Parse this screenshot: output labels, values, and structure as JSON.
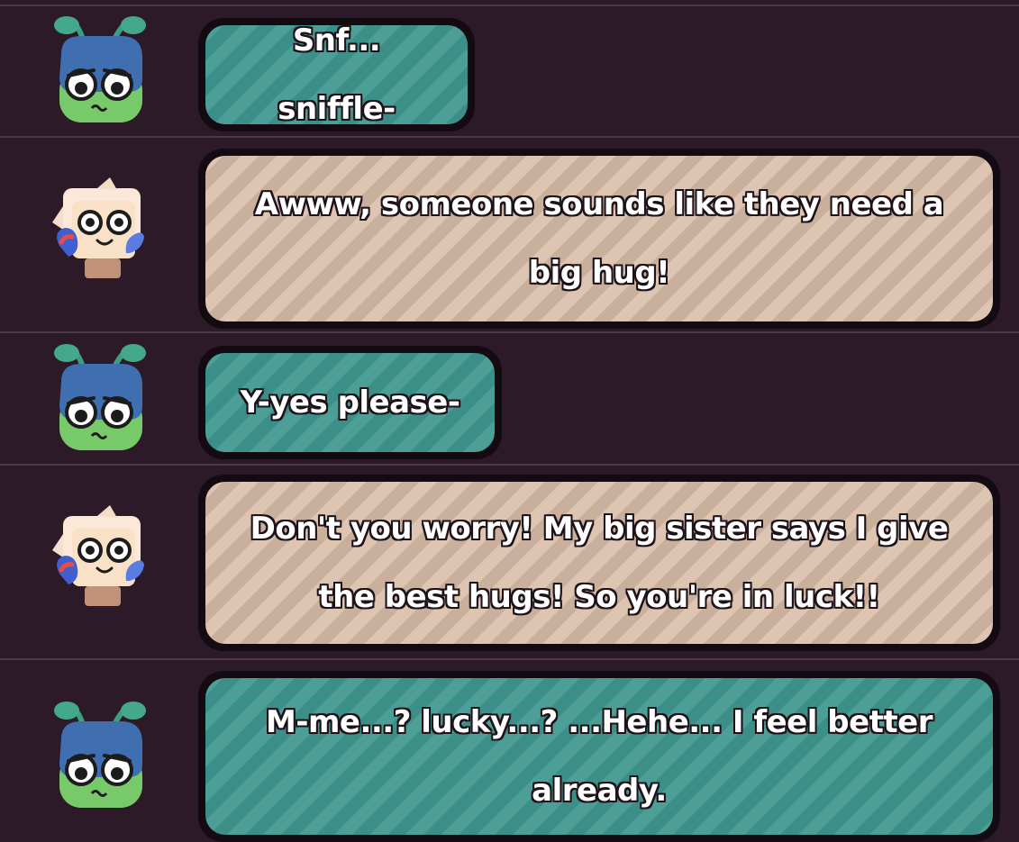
{
  "colors": {
    "background": "#2d1a28",
    "divider": "#4c3a47",
    "teal_bubble": "#3f978f",
    "tan_bubble": "#d8bda8",
    "bubble_border": "#140b12"
  },
  "messages": [
    {
      "speaker_icon": "green-bug-character-icon",
      "style": "teal",
      "text": "Snf... sniffle-"
    },
    {
      "speaker_icon": "cream-hair-character-icon",
      "style": "tan",
      "text": "Awww, someone sounds like they need a big hug!"
    },
    {
      "speaker_icon": "green-bug-character-icon",
      "style": "teal",
      "text": "Y-yes please-"
    },
    {
      "speaker_icon": "cream-hair-character-icon",
      "style": "tan",
      "text": "Don't you worry! My big sister says I give the best hugs! So you're in luck!!"
    },
    {
      "speaker_icon": "green-bug-character-icon",
      "style": "teal",
      "text": "M-me...? lucky...? ...Hehe... I feel better already."
    }
  ]
}
